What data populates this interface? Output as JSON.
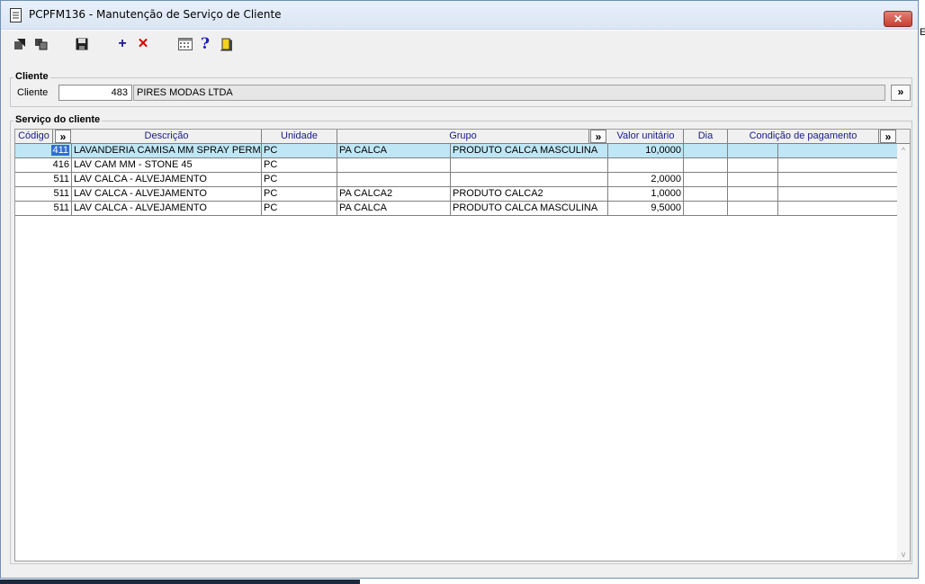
{
  "window": {
    "title": "PCPFM136 - Manutenção de Serviço de Cliente",
    "close_label": "✕"
  },
  "toolbar": {
    "items": [
      {
        "name": "navigate-icon"
      },
      {
        "name": "copy-icon"
      },
      {
        "name": "save-icon"
      },
      {
        "name": "add-icon",
        "glyph": "+"
      },
      {
        "name": "delete-icon",
        "glyph": "✕"
      },
      {
        "name": "calendar-icon"
      },
      {
        "name": "help-icon",
        "glyph": "?"
      },
      {
        "name": "exit-icon"
      }
    ]
  },
  "cliente": {
    "group_label": "Cliente",
    "field_label": "Cliente",
    "code": "483",
    "name": "PIRES MODAS LTDA",
    "lookup_label": "»"
  },
  "servico": {
    "group_label": "Serviço do cliente",
    "columns": {
      "codigo": "Código",
      "codigo_btn": "»",
      "descricao": "Descrição",
      "unidade": "Unidade",
      "grupo": "Grupo",
      "grupo_btn": "»",
      "valor": "Valor unitário",
      "dia": "Dia",
      "condicao": "Condição de pagamento",
      "condicao_btn": "»"
    },
    "rows": [
      {
        "codigo": "411",
        "descricao": "LAVANDERIA CAMISA MM SPRAY PERMANENTE",
        "unidade": "PC",
        "grupo": "PA CALCA",
        "grupo_desc": "PRODUTO CALCA MASCULINA",
        "valor": "10,0000",
        "dia": "",
        "condicao": "",
        "extra": ""
      },
      {
        "codigo": "416",
        "descricao": "LAV CAM MM - STONE 45",
        "unidade": "PC",
        "grupo": "",
        "grupo_desc": "",
        "valor": "",
        "dia": "",
        "condicao": "",
        "extra": ""
      },
      {
        "codigo": "511",
        "descricao": "LAV CALCA - ALVEJAMENTO",
        "unidade": "PC",
        "grupo": "",
        "grupo_desc": "",
        "valor": "2,0000",
        "dia": "",
        "condicao": "",
        "extra": ""
      },
      {
        "codigo": "511",
        "descricao": "LAV CALCA - ALVEJAMENTO",
        "unidade": "PC",
        "grupo": "PA CALCA2",
        "grupo_desc": "PRODUTO CALCA2",
        "valor": "1,0000",
        "dia": "",
        "condicao": "",
        "extra": ""
      },
      {
        "codigo": "511",
        "descricao": "LAV CALCA - ALVEJAMENTO",
        "unidade": "PC",
        "grupo": "PA CALCA",
        "grupo_desc": "PRODUTO CALCA MASCULINA",
        "valor": "9,5000",
        "dia": "",
        "condicao": "",
        "extra": ""
      }
    ]
  },
  "scrollbar": {
    "up": "^",
    "down": "v"
  },
  "edge_text": "E"
}
